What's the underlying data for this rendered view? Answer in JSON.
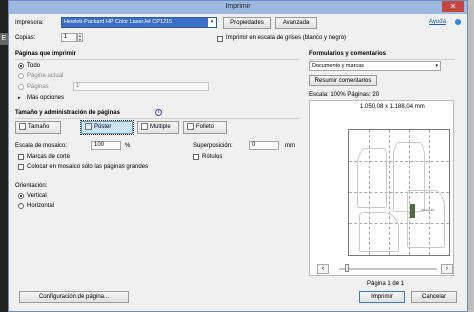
{
  "window": {
    "title": "Imprimir"
  },
  "background": {
    "left_letter": "E"
  },
  "top": {
    "printer_label": "Impresora:",
    "printer_value": "Hewlett-Packard HP Color LaserJet CP1215",
    "properties_button": "Propiedades",
    "advanced_button": "Avanzada",
    "help_link": "Ayuda",
    "copies_label": "Copias:",
    "copies_value": "1",
    "grayscale_label": "Imprimir en escala de grises (blanco y negro)"
  },
  "pages": {
    "heading": "Páginas que imprimir",
    "all": "Todo",
    "current": "Página actual",
    "pages_label": "Páginas",
    "pages_value": "1",
    "more_options": "Más opciones"
  },
  "sizing": {
    "heading": "Tamaño y administración de páginas",
    "info_icon": "info-icon",
    "modes": [
      "Tamaño",
      "Póster",
      "Múltiple",
      "Folleto"
    ],
    "selected_mode": "Póster",
    "tile_scale_label": "Escala de mosaico:",
    "tile_scale_value": "100",
    "tile_scale_unit": "%",
    "overlap_label": "Superposición:",
    "overlap_value": "0",
    "overlap_unit": "mm",
    "cut_marks": "Marcas de corte",
    "labels": "Rótulos",
    "large_only": "Colocar en mosaico sólo las páginas grandes"
  },
  "orientation": {
    "heading": "Orientación:",
    "vertical": "Vertical",
    "horizontal": "Horizontal",
    "selected": "Vertical"
  },
  "forms": {
    "heading": "Formularios y comentarios",
    "select_value": "Documento y marcas",
    "summarize_button": "Resumir comentarios"
  },
  "preview": {
    "scale_text": "Escala: 100% Páginas: 20",
    "dimensions": "1.050,08 x 1.188,04 mm",
    "page_indicator": "Página 1 de 1",
    "prev_icon": "chevron-left-icon",
    "next_icon": "chevron-right-icon",
    "talla_text": "TALLA 44"
  },
  "bottom": {
    "page_setup_button": "Configuración de página...",
    "print_button": "Imprimir",
    "cancel_button": "Cancelar"
  }
}
